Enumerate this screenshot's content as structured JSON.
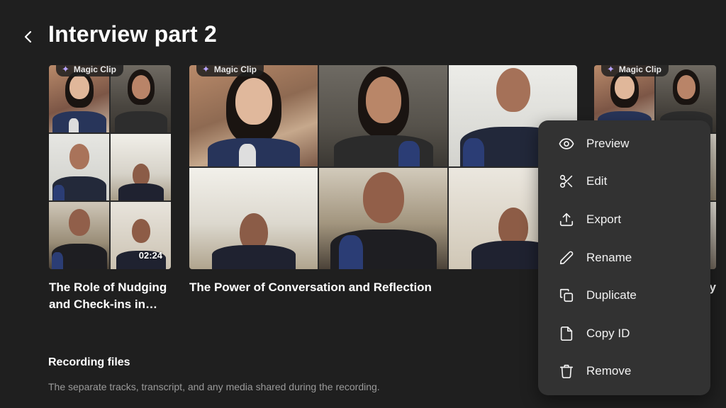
{
  "header": {
    "title": "Interview part 2"
  },
  "clips": [
    {
      "badge": "Magic Clip",
      "title": "The Role of Nudging and Check-ins in…",
      "duration": "02:24"
    },
    {
      "badge": "Magic Clip",
      "title": "The Power of Conversation and Reflection"
    },
    {
      "badge": "Magic Clip",
      "title": "y"
    }
  ],
  "recording": {
    "title": "Recording files",
    "description": "The separate tracks, transcript, and any media shared during the recording."
  },
  "menu": {
    "items": [
      {
        "label": "Preview",
        "icon": "eye-icon"
      },
      {
        "label": "Edit",
        "icon": "scissors-icon"
      },
      {
        "label": "Export",
        "icon": "upload-icon"
      },
      {
        "label": "Rename",
        "icon": "pencil-icon"
      },
      {
        "label": "Duplicate",
        "icon": "copy-icon"
      },
      {
        "label": "Copy ID",
        "icon": "file-icon"
      },
      {
        "label": "Remove",
        "icon": "trash-icon"
      }
    ]
  },
  "colors": {
    "background": "#1f1f1f",
    "menu_background": "#323232",
    "accent_star": "#b8a4ff",
    "muted_text": "#9a9a9a"
  }
}
